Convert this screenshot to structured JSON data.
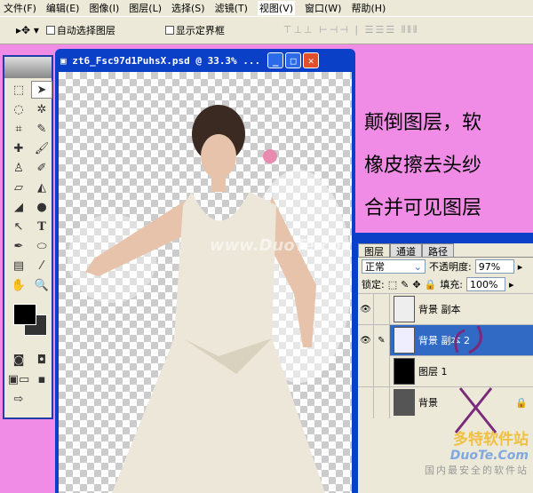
{
  "menu": [
    "文件(F)",
    "编辑(E)",
    "图像(I)",
    "图层(L)",
    "选择(S)",
    "滤镜(T)",
    "视图(V)",
    "窗口(W)",
    "帮助(H)"
  ],
  "options": {
    "auto_select": "自动选择图层",
    "show_bounds": "显示定界框",
    "auto_select_checked": false,
    "show_bounds_checked": false
  },
  "document": {
    "title": "zt6_Fsc97d1PuhsX.psd @ 33.3% ...",
    "watermark": "www.DuoTe.com"
  },
  "note": [
    "颠倒图层，软",
    "橡皮擦去头纱",
    "合并可见图层"
  ],
  "layers_panel": {
    "tabs": [
      "图层",
      "通道",
      "路径"
    ],
    "blend_mode": "正常",
    "opacity_label": "不透明度:",
    "opacity": "97%",
    "lock_label": "锁定:",
    "fill_label": "填充:",
    "fill": "100%",
    "layers": [
      {
        "name": "背景 副本",
        "visible": true,
        "selected": false
      },
      {
        "name": "背景 副本 2",
        "visible": true,
        "selected": true
      },
      {
        "name": "图层 1",
        "visible": false,
        "selected": false
      },
      {
        "name": "背景",
        "visible": false,
        "selected": false,
        "locked": true
      }
    ]
  },
  "site_logo": {
    "name": "多特软件站",
    "url_text": "DuoTe.Com",
    "slogan": "国内最安全的软件站"
  },
  "colors": {
    "background": "#f18ce6",
    "selection": "#316ac5",
    "titlebar": "#0a3fc8"
  }
}
